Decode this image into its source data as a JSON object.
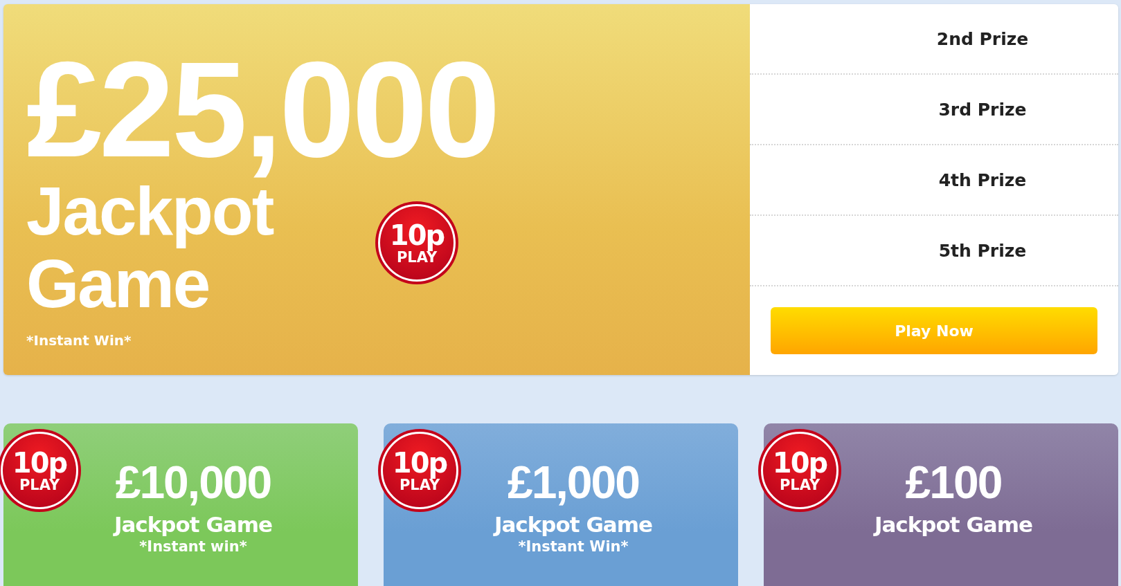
{
  "jackpot": {
    "amount": "£25,000",
    "title_lines": [
      "Jackpot",
      "Game"
    ],
    "subtitle": "*Instant Win*",
    "badge": {
      "price": "10p",
      "label": "PLAY"
    }
  },
  "prizes": [
    "2nd Prize",
    "3rd Prize",
    "4th Prize",
    "5th Prize"
  ],
  "play_button": "Play Now",
  "games": [
    {
      "amount": "£10,000",
      "title": "Jackpot Game",
      "subtitle": "*Instant win*",
      "color": "#7cc85a",
      "badge": {
        "price": "10p",
        "label": "PLAY"
      }
    },
    {
      "amount": "£1,000",
      "title": "Jackpot Game",
      "subtitle": "*Instant Win*",
      "color": "#6a9fd4",
      "badge": {
        "price": "10p",
        "label": "PLAY"
      }
    },
    {
      "amount": "£100",
      "title": "Jackpot Game",
      "color": "#7e6c94",
      "badge": {
        "price": "10p",
        "label": "PLAY"
      }
    }
  ]
}
